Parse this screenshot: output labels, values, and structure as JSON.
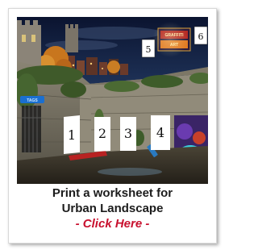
{
  "artwork": {
    "panels": [
      "1",
      "2",
      "3",
      "4"
    ],
    "signs": [
      "5",
      "6"
    ]
  },
  "caption": {
    "line1": "Print a worksheet for",
    "line2": "Urban Landscape",
    "link_text": "- Click Here -"
  },
  "colors": {
    "link": "#c8102e",
    "caption_text": "#1c1c1c"
  }
}
